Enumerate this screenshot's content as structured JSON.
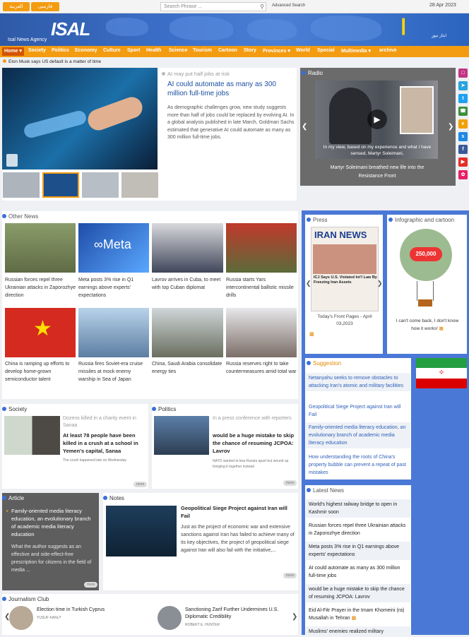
{
  "topbar": {
    "lang1": "العربية",
    "lang2": "فارسی",
    "search_placeholder": "Search Phrase ...",
    "advanced": "Advanced Search",
    "date": "28 Apr 2023"
  },
  "banner": {
    "agency": "Isal News Agency",
    "logo_text": "ISAL",
    "right_text": "ایثار نیوز"
  },
  "nav": {
    "items": [
      "Home",
      "Society",
      "Politics",
      "Economy",
      "Culture",
      "Sport",
      "Health",
      "Science",
      "Tourism",
      "Cartoon",
      "Story",
      "Provinces",
      "World",
      "Special",
      "Multimedia",
      "archive"
    ]
  },
  "ticker": {
    "text": "Elon Musk says US default is a matter of time"
  },
  "lead": {
    "kicker": "AI may put half jobs at risk",
    "title": "AI could automate as many as 300 million full-time jobs",
    "body": "As demographic challenges grow, new study suggests more than half of jobs could be replaced by evolving AI. In a global analysis published in late March, Goldman Sachs estimated that generative AI could automate as many as 300 million full-time jobs."
  },
  "radio": {
    "heading": "Radio",
    "subtitle": "In my view, based on my experience and what I have sensed, Martyr Soleimani,",
    "caption": "Martyr Soleimani breathed new life into the Resistance Front"
  },
  "other_news": {
    "heading": "Other News",
    "items": [
      "Russian forces repel three Ukrainian attacks in Zaporozhye direction",
      "Meta posts 3% rise in Q1 earnings above experts' expectations",
      "Lavrov arrives in Cuba, to meet with top Cuban diplomat",
      "Russia starts Yars intercontinental ballistic missile drills",
      "China is ramping up efforts to develop home-grown semiconductor talent",
      "Russia fires Soviet-era cruise missiles at mock enemy warship in Sea of Japan",
      "China, Saudi Arabia consolidate energy ties",
      "Russia reserves right to take countermeasures amid total war"
    ]
  },
  "press": {
    "heading": "Press",
    "paper": "IRAN NEWS",
    "paper_headline": "ICJ Says U.S. Violated Int'l Law By Freezing Iran Assets",
    "caption": "Today's Front Pages - April 03,2023"
  },
  "infographic": {
    "heading": "Infographic and cartoon",
    "number": "250,000",
    "caption": "I can't come back, I don't know how it works!"
  },
  "suggestion": {
    "heading": "Suggestion",
    "items": [
      "Netanyahu seeks to remove obstacles to attacking Iran's atomic and military facilities",
      "Geopolitical Siege Project against Iran will Fail",
      "Family-oriented media literacy education, an evolutionary branch of academic media literacy education",
      "How understanding the roots of China's property bubble can prevent a repeat of past mistakes"
    ]
  },
  "latest": {
    "heading": "Latest News",
    "items": [
      "World's highest railway bridge to open in Kashmir soon",
      "Russian forces repel three Ukrainian attacks in Zaporozhye direction",
      "Meta posts 3% rise in Q1 earnings above experts' expectations",
      "AI could automate as many as 300 million full-time jobs",
      "would be a huge mistake to skip the chance of resuming JCPOA: Lavrov",
      "Eid Al-Fitr Prayer in the Imam Khomeini (ra) Musallah in Tehran",
      "Muslims' enemies realized military"
    ]
  },
  "society": {
    "heading": "Society",
    "kicker": "Dozens killed in a charity event in Sanaa",
    "title": "At least 78 people have been killed in a crush at a school in Yemen's capital, Sanaa",
    "note": "The crush happened late on Wednesday",
    "more": "more"
  },
  "politics": {
    "heading": "Politics",
    "kicker": "In a press conference with reporters",
    "title": "would be a huge mistake to skip the chance of resuming JCPOA: Lavrov",
    "note": "NATO wanted to tear Russia apart but wound up bringing it together instead",
    "more": "more"
  },
  "article": {
    "heading": "Article",
    "title": "Family-oriented media literacy education, an evolutionary branch of academic media literacy education",
    "body": "What the author suggests as an effective and side-effect-free prescription for citizens in the field of media ...",
    "more": "more"
  },
  "notes": {
    "heading": "Notes",
    "title": "Geopolitical Siege Project against Iran will Fail",
    "body": "Just as the project of economic war and extensive sanctions against Iran has failed to achieve many of its key objectives, the project of geopolitical siege against Iran will also fail with the initiative,...",
    "more": "more"
  },
  "journalism": {
    "heading": "Journalism Club",
    "items": [
      {
        "title": "Election time in Turkish Cyprus",
        "author": "YUSUF KANLI*"
      },
      {
        "title": "Sanctioning Zarif Further Undermines U.S. Diplomatic Credibility",
        "author": "ROBERT E. HUNTER"
      }
    ]
  }
}
